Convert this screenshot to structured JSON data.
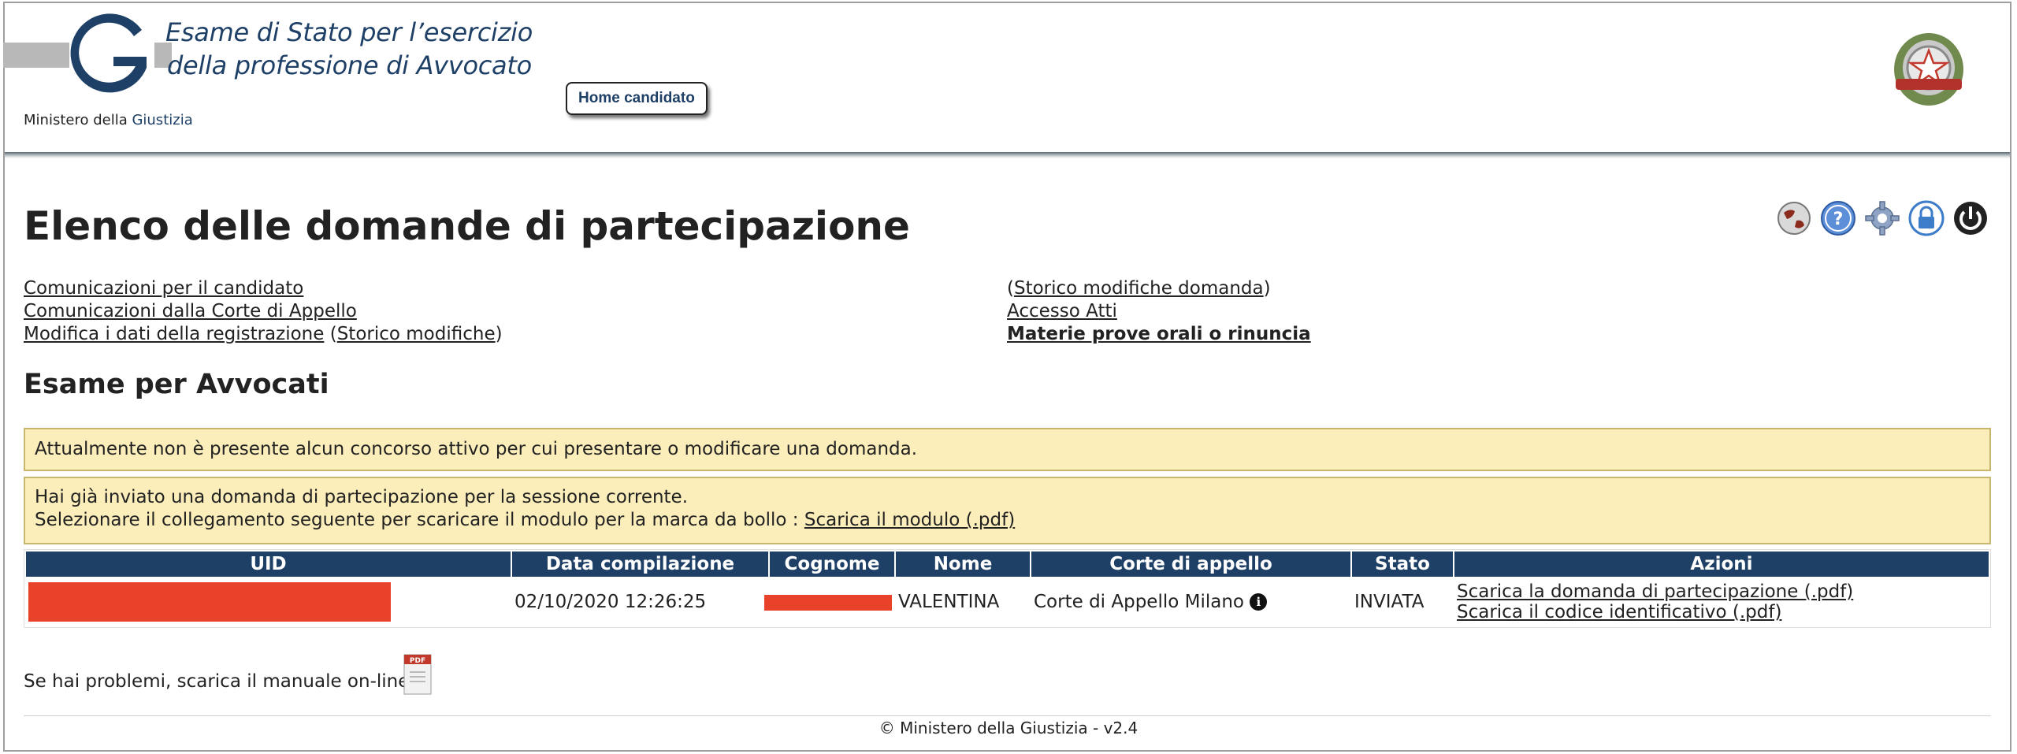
{
  "header": {
    "title_line1": "Esame di Stato per l’esercizio",
    "title_line2": "della professione di Avvocato",
    "ministero_prefix": "Ministero della ",
    "ministero_suffix": "Giustizia",
    "home_button": "Home candidato",
    "brand_color": "#1e3f66"
  },
  "toolbar": {
    "icons": [
      "globe-icon",
      "help-icon",
      "settings-gear-icon",
      "lock-icon",
      "power-icon"
    ]
  },
  "page": {
    "title": "Elenco delle domande di partecipazione",
    "links_left": [
      {
        "label": "Comunicazioni per il candidato"
      },
      {
        "label": "Comunicazioni dalla Corte di Appello"
      },
      {
        "label": "Modifica i dati della registrazione",
        "extra": "Storico modifiche"
      }
    ],
    "links_right": [
      {
        "label": "Storico modifiche domanda"
      },
      {
        "label": "Accesso Atti"
      },
      {
        "label": "Materie prove orali o rinuncia"
      }
    ],
    "section_title": "Esame per Avvocati"
  },
  "notices": {
    "notice1": "Attualmente non è presente alcun concorso attivo per cui presentare o modificare una domanda.",
    "notice2_line1": "Hai già inviato una domanda di partecipazione per la sessione corrente.",
    "notice2_line2": "Selezionare il collegamento seguente per scaricare il modulo per la marca da bollo : ",
    "notice2_link": "Scarica il modulo (.pdf)",
    "bg_color": "#fbeebb"
  },
  "table": {
    "headers": [
      "UID",
      "Data compilazione",
      "Cognome",
      "Nome",
      "Corte di appello",
      "Stato",
      "Azioni"
    ],
    "rows": [
      {
        "uid": "",
        "data": "02/10/2020 12:26:25",
        "cognome": "",
        "nome": "VALENTINA",
        "corte": "Corte di Appello Milano",
        "stato": "INVIATA",
        "azione1": "Scarica la domanda di partecipazione (.pdf)",
        "azione2": "Scarica il codice identificativo (.pdf)"
      }
    ],
    "header_color": "#1e3f66",
    "redaction_color": "#e8432a"
  },
  "manual": {
    "text": "Se hai problemi, scarica il manuale on-line",
    "icon_label": "PDF"
  },
  "footer": {
    "text": "© Ministero della Giustizia  - v2.4"
  }
}
